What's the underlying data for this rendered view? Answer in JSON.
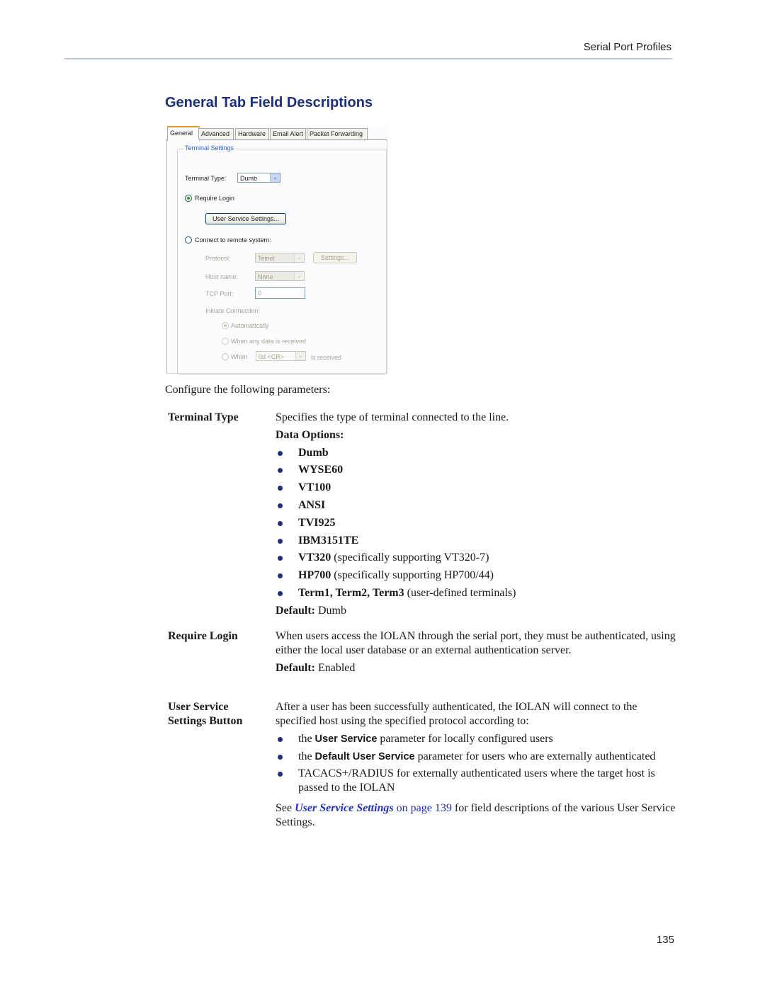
{
  "header": {
    "running_head": "Serial Port Profiles"
  },
  "section_title": "General Tab Field Descriptions",
  "dialog": {
    "tabs": [
      "General",
      "Advanced",
      "Hardware",
      "Email Alert",
      "Packet Forwarding"
    ],
    "active_tab": "General",
    "group_label": "Terminal Settings",
    "terminal_type_label": "Terminal Type:",
    "terminal_type_value": "Dumb",
    "require_login_label": "Require Login",
    "require_login_selected": true,
    "user_service_button": "User Service Settings...",
    "connect_remote_label": "Connect to remote system:",
    "protocol_label": "Protocol:",
    "protocol_value": "Telnet",
    "settings_button": "Settings...",
    "host_name_label": "Host name:",
    "host_name_value": "None",
    "tcp_port_label": "TCP Port:",
    "tcp_port_value": "0",
    "initiate_label": "Initiate Connection:",
    "initiate_options": [
      "Automatically",
      "When any data is received",
      "When"
    ],
    "initiate_selected": "Automatically",
    "when_value": "0d  <CR>",
    "is_received": "is received"
  },
  "intro": "Configure the following parameters:",
  "fields": {
    "terminal_type": {
      "term": "Terminal Type",
      "desc": "Specifies the type of terminal connected to the line.",
      "options_label": "Data Options:",
      "options": [
        {
          "bold": "Dumb",
          "rest": ""
        },
        {
          "bold": "WYSE60",
          "rest": ""
        },
        {
          "bold": "VT100",
          "rest": ""
        },
        {
          "bold": "ANSI",
          "rest": ""
        },
        {
          "bold": "TVI925",
          "rest": ""
        },
        {
          "bold": "IBM3151TE",
          "rest": ""
        },
        {
          "bold": "VT320",
          "rest": " (specifically supporting VT320-7)"
        },
        {
          "bold": "HP700",
          "rest": " (specifically supporting HP700/44)"
        },
        {
          "bold": "Term1, Term2, Term3",
          "rest": " (user-defined terminals)"
        }
      ],
      "default_label": "Default:",
      "default_value": " Dumb"
    },
    "require_login": {
      "term": "Require Login",
      "desc": "When users access the IOLAN through the serial port, they must be authenticated, using either the local user database or an external authentication server.",
      "default_label": "Default:",
      "default_value": " Enabled"
    },
    "user_service": {
      "term_line1": "User Service",
      "term_line2": "Settings Button",
      "desc": "After a user has been successfully authenticated, the IOLAN will connect to the specified host using the specified protocol according to:",
      "bullets": [
        {
          "pre": "the ",
          "bold": "User Service",
          "post": " parameter for locally configured users"
        },
        {
          "pre": "the ",
          "bold": "Default User Service",
          "post": " parameter for users who are externally authenticated"
        },
        {
          "pre": "TACACS+/RADIUS for externally authenticated users where the target host is passed to the IOLAN",
          "bold": "",
          "post": ""
        }
      ],
      "see_pre": "See ",
      "see_link_title": "User Service Settings",
      "see_link_page": " on page 139",
      "see_post": " for field descriptions of the various User Service Settings."
    }
  },
  "footer": {
    "page_number": "135"
  }
}
